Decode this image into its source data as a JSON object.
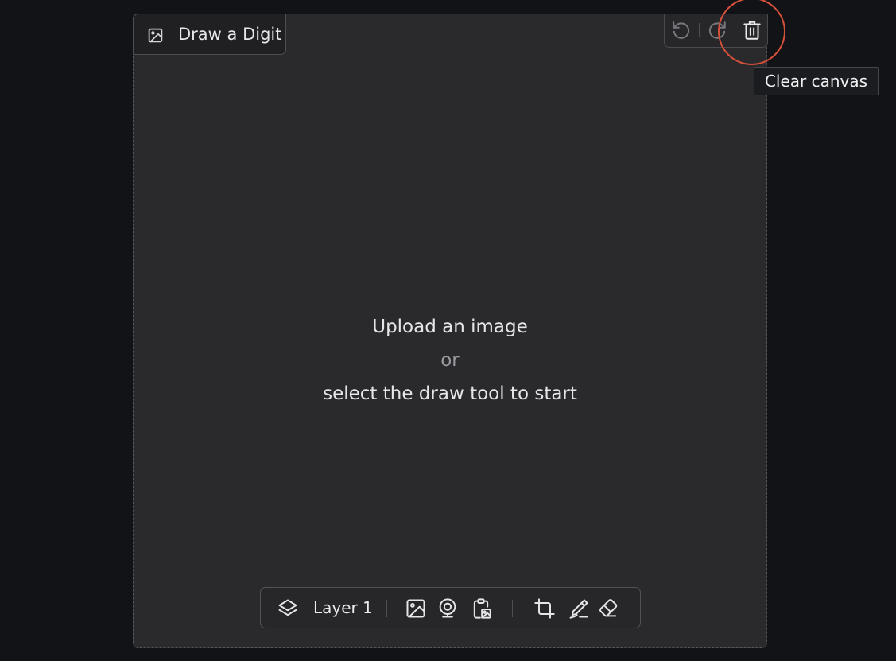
{
  "image_editor": {
    "label": "Draw a Digit",
    "placeholder": {
      "line1": "Upload an image",
      "line2": "or",
      "line3": "select the draw tool to start"
    },
    "history": {
      "undo_icon": "undo-icon",
      "redo_icon": "redo-icon",
      "clear_icon": "trash-icon"
    },
    "tooltip": "Clear canvas",
    "toolbar": {
      "layer_label": "Layer 1",
      "icons": [
        "layers-icon",
        "image-upload-icon",
        "webcam-icon",
        "clipboard-paste-icon",
        "crop-icon",
        "brush-icon",
        "eraser-icon"
      ]
    }
  },
  "colors": {
    "page_background": "#121317",
    "panel_background": "#2a2a2d",
    "highlight_ring": "#d8513a"
  }
}
